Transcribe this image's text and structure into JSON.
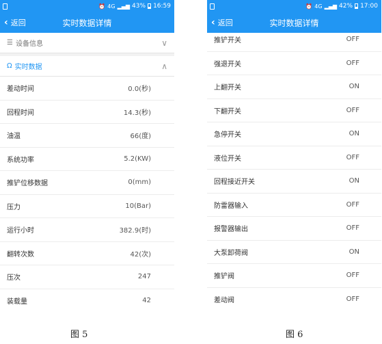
{
  "figure5": {
    "status": {
      "alarm_icon": "alarm-clock-icon",
      "network": "4G",
      "battery": "43%",
      "time": "16:59"
    },
    "back_label": "返回",
    "title": "实时数据详情",
    "section_device": "设备信息",
    "section_realtime": "实时数据",
    "rows": [
      {
        "label": "差动时间",
        "value": "0.0(秒)"
      },
      {
        "label": "回程时间",
        "value": "14.3(秒)"
      },
      {
        "label": "油温",
        "value": "66(度)"
      },
      {
        "label": "系统功率",
        "value": "5.2(KW)"
      },
      {
        "label": "推铲位移数据",
        "value": "0(mm)"
      },
      {
        "label": "压力",
        "value": "10(Bar)"
      },
      {
        "label": "运行小时",
        "value": "382.9(时)"
      },
      {
        "label": "翻转次数",
        "value": "42(次)"
      },
      {
        "label": "压次",
        "value": "247"
      },
      {
        "label": "装载量",
        "value": "42"
      }
    ],
    "caption": "图 5"
  },
  "figure6": {
    "status": {
      "alarm_icon": "alarm-clock-icon",
      "network": "4G",
      "battery": "42%",
      "time": "17:00"
    },
    "back_label": "返回",
    "title": "实时数据详情",
    "rows": [
      {
        "label": "推铲开关",
        "value": "OFF"
      },
      {
        "label": "强退开关",
        "value": "OFF"
      },
      {
        "label": "上翻开关",
        "value": "ON"
      },
      {
        "label": "下翻开关",
        "value": "OFF"
      },
      {
        "label": "急停开关",
        "value": "ON"
      },
      {
        "label": "液位开关",
        "value": "OFF"
      },
      {
        "label": "回程接近开关",
        "value": "ON"
      },
      {
        "label": "防雷器输入",
        "value": "OFF"
      },
      {
        "label": "报警器输出",
        "value": "OFF"
      },
      {
        "label": "大泵卸荷阀",
        "value": "ON"
      },
      {
        "label": "推铲阀",
        "value": "OFF"
      },
      {
        "label": "差动阀",
        "value": "OFF"
      }
    ],
    "caption": "图 6"
  },
  "colors": {
    "primary": "#2196f3",
    "divider": "#ececec"
  }
}
